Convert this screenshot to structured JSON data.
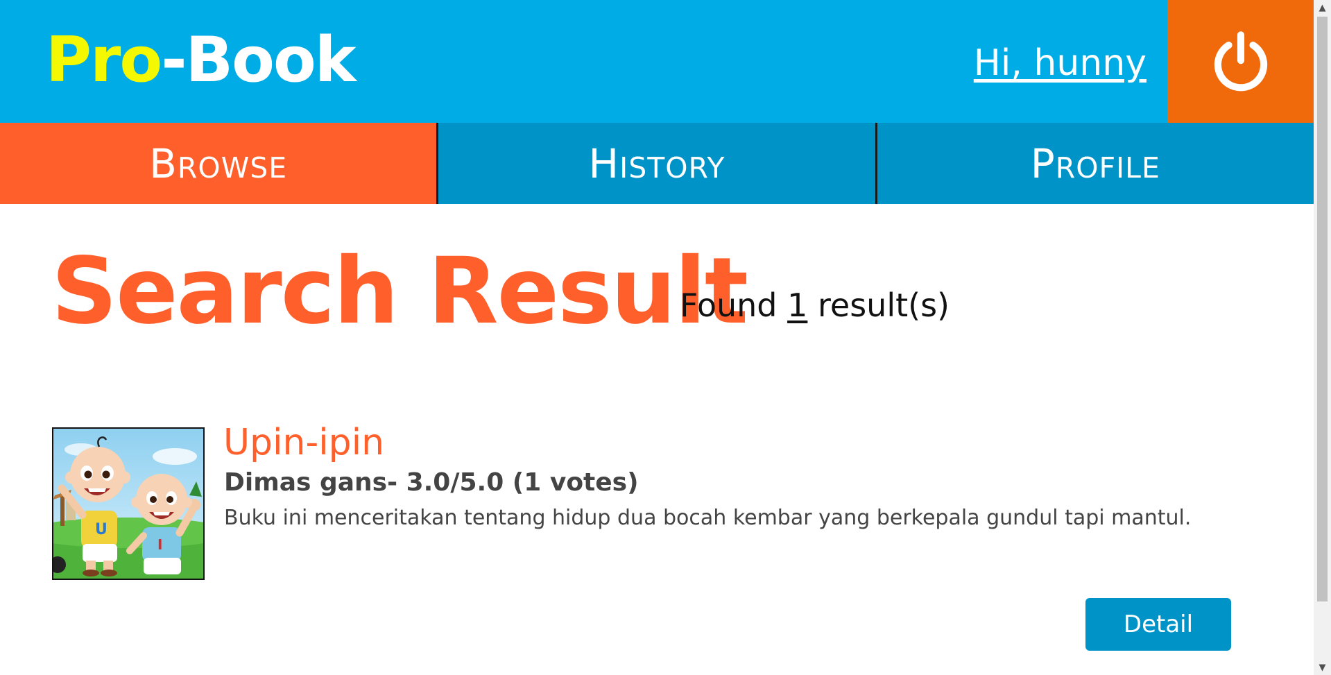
{
  "header": {
    "logo_part1": "Pro",
    "logo_part2": "-Book",
    "greeting": "Hi, hunny",
    "logout_icon": "power-icon"
  },
  "nav": {
    "tabs": [
      {
        "label": "Browse",
        "active": true
      },
      {
        "label": "History",
        "active": false
      },
      {
        "label": "Profile",
        "active": false
      }
    ]
  },
  "main": {
    "title": "Search Result",
    "found_prefix": "Found ",
    "found_count": "1",
    "found_suffix": " result(s)"
  },
  "results": [
    {
      "title": "Upin-ipin",
      "author_rating": "Dimas gans- 3.0/5.0 (1 votes)",
      "description": "Buku ini menceritakan tentang hidup dua bocah kembar yang berkepala gundul tapi mantul.",
      "cover_icon": "book-cover-image",
      "button_label": "Detail"
    }
  ],
  "colors": {
    "header_blue": "#00ace6",
    "nav_blue": "#0093c8",
    "accent_orange": "#ff5f2b",
    "logout_orange": "#f0690a",
    "logo_yellow": "#f4f800"
  }
}
